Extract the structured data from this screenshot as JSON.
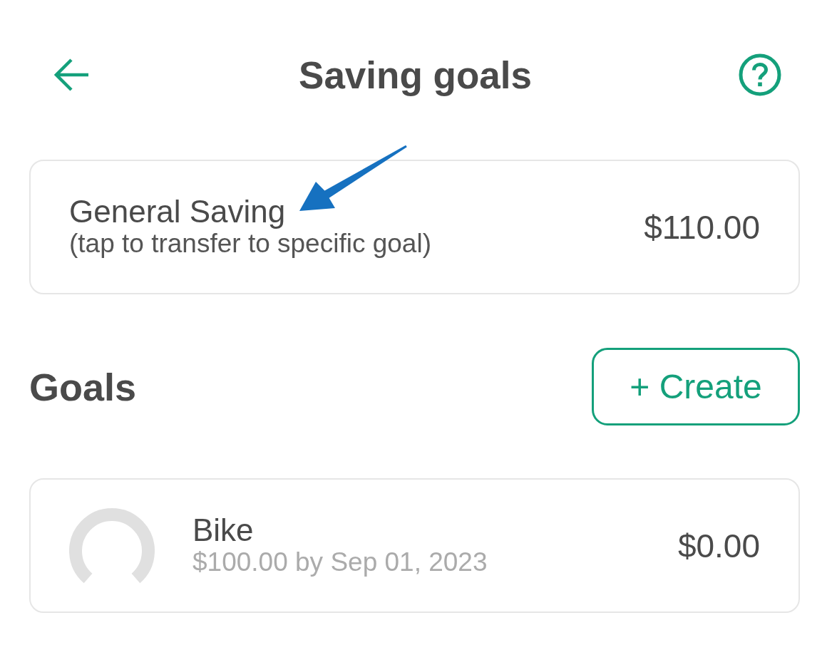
{
  "header": {
    "title": "Saving goals"
  },
  "general_saving": {
    "title": "General Saving",
    "hint": "(tap to transfer to specific goal)",
    "amount": "$110.00"
  },
  "goals_section": {
    "heading": "Goals",
    "create_button": "+ Create"
  },
  "goals": [
    {
      "name": "Bike",
      "target": "$100.00 by Sep 01, 2023",
      "amount": "$0.00"
    }
  ]
}
